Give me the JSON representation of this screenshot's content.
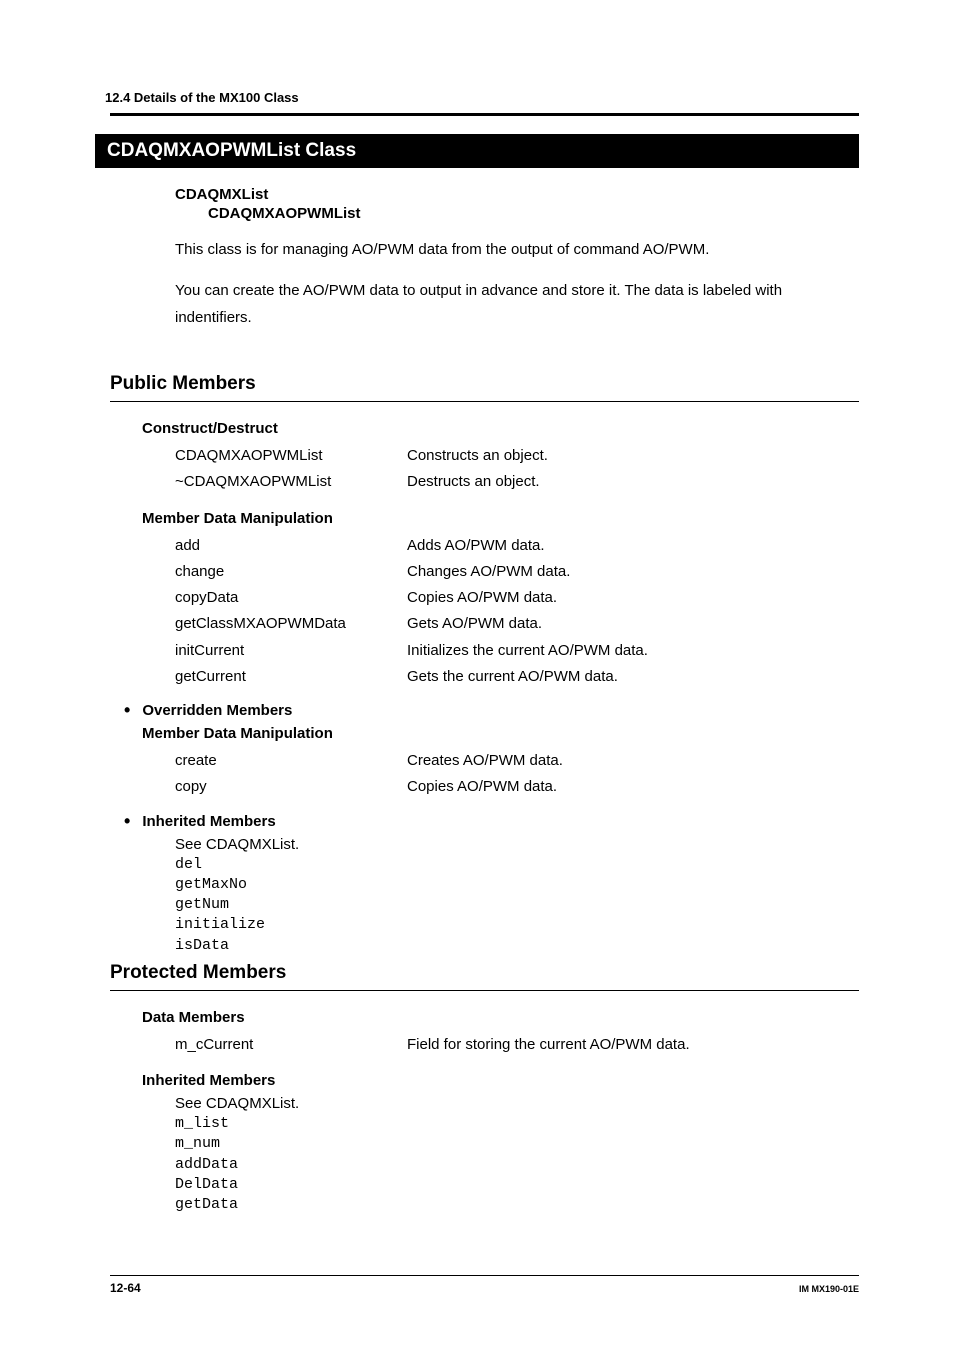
{
  "header": {
    "section": "12.4  Details of the MX100 Class"
  },
  "title": "CDAQMXAOPWMList Class",
  "hierarchy": {
    "parent": "CDAQMXList",
    "child": "CDAQMXAOPWMList"
  },
  "description": {
    "line1": "This class is for managing AO/PWM data from the output of command AO/PWM.",
    "line2": "You can create the AO/PWM data to output in advance and store it. The data is labeled with indentifiers."
  },
  "public_members": {
    "heading": "Public Members",
    "construct": {
      "heading": "Construct/Destruct",
      "items": [
        {
          "name": "CDAQMXAOPWMList",
          "desc": "Constructs an object."
        },
        {
          "name": "~CDAQMXAOPWMList",
          "desc": "Destructs an object."
        }
      ]
    },
    "member_data": {
      "heading": "Member Data Manipulation",
      "items": [
        {
          "name": "add",
          "desc": "Adds AO/PWM data."
        },
        {
          "name": "change",
          "desc": "Changes AO/PWM data."
        },
        {
          "name": "copyData",
          "desc": "Copies AO/PWM data."
        },
        {
          "name": "getClassMXAOPWMData",
          "desc": "Gets AO/PWM data."
        },
        {
          "name": "initCurrent",
          "desc": "Initializes the current AO/PWM data."
        },
        {
          "name": "getCurrent",
          "desc": "Gets the current AO/PWM data."
        }
      ]
    },
    "overridden": {
      "heading": "Overridden Members",
      "sub_heading": "Member Data Manipulation",
      "items": [
        {
          "name": "create",
          "desc": "Creates AO/PWM data."
        },
        {
          "name": "copy",
          "desc": "Copies AO/PWM data."
        }
      ]
    },
    "inherited": {
      "heading": "Inherited Members",
      "note": "See CDAQMXList.",
      "code_items": [
        "del",
        "getMaxNo",
        "getNum",
        "initialize",
        "isData"
      ]
    }
  },
  "protected_members": {
    "heading": "Protected Members",
    "data_members": {
      "heading": "Data Members",
      "items": [
        {
          "name": "m_cCurrent",
          "desc": "Field for storing the current AO/PWM data."
        }
      ]
    },
    "inherited": {
      "heading": "Inherited Members",
      "note": "See CDAQMXList.",
      "code_items": [
        "m_list",
        "m_num",
        "addData",
        "DelData",
        "getData"
      ]
    }
  },
  "footer": {
    "page": "12-64",
    "doc_id": "IM MX190-01E"
  }
}
